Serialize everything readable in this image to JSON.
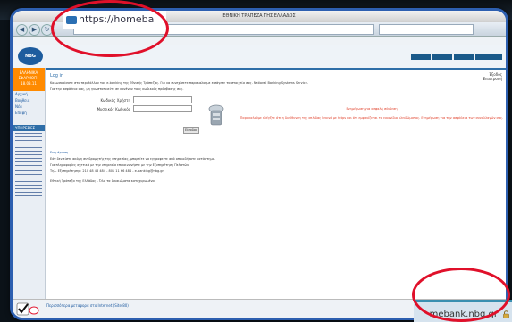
{
  "browser": {
    "window_title": "ΕΘΝΙΚΗ ΤΡΑΠΕΖΑ ΤΗΣ ΕΛΛΑΔΟΣ",
    "url_zoom": "https://homeba",
    "domain_zoom": "mebank.nbg.gr",
    "status_link": "Περισσότερα μεταφορά στο Internet (Site 80)"
  },
  "bank": {
    "logo_text": "NBG",
    "date_block": "ΕΛΛΗΝΙΚΑ\nΕΦΑΡΜΟΓΗ\n18.03.11",
    "sidebar_links": [
      "Αρχική",
      "Βοήθεια",
      "Νέα",
      "Επαφή"
    ],
    "sidebar_head": "ΥΠΗΡΕΣΙΕΣ",
    "page_title": "Log in",
    "logout": "Έξοδος\nΕπιστροφή",
    "intro": "Καλωσορίσατε στο περιβάλλον του e-banking της Εθνικής Τράπεζας. Για να συνεχίσετε παρακαλούμε εισάγετε τα στοιχεία σας. National Banking Systems Service.",
    "intro2": "Για την ασφάλεια σας, μη γνωστοποιείτε σε κανέναν τους κωδικούς πρόσβασης σας.",
    "username_label": "Κωδικός Χρήστη",
    "password_label": "Μυστικός Κωδικός",
    "login_button": "Είσοδος",
    "error_title": "Ενημέρωση για ασφαλή σύνδεση",
    "error_text": "Παρακαλούμε ελέγξτε ότι η διεύθυνση της σελίδας ξεκινά με https και ότι εμφανίζεται το εικονίδιο κλειδώματος. Ενημέρωση για την ασφάλεια των συναλλαγών σας.",
    "help_title": "Ενημέρωση",
    "help_lines": [
      "Εάν δεν είστε ακόμη συνδρομητής της υπηρεσίας, μπορείτε να εγγραφείτε από οποιοδήποτε κατάστημα.",
      "Για πληροφορίες σχετικά με την υπηρεσία επικοινωνήστε με την Εξυπηρέτηση Πελατών.",
      "Τηλ. Εξυπηρέτησης: 210 48 48 484 - 801 11 66 484 - e-banking@nbg.gr",
      "Εθνική Τράπεζα της Ελλάδος - Όλα τα δικαιώματα κατοχυρωμένα."
    ],
    "top_buttons": [
      "",
      "",
      "",
      ""
    ]
  },
  "colors": {
    "frame": "#2d5fb0",
    "ring": "#e0102a",
    "accent": "#ff8a00",
    "brand": "#1d5c9e"
  }
}
